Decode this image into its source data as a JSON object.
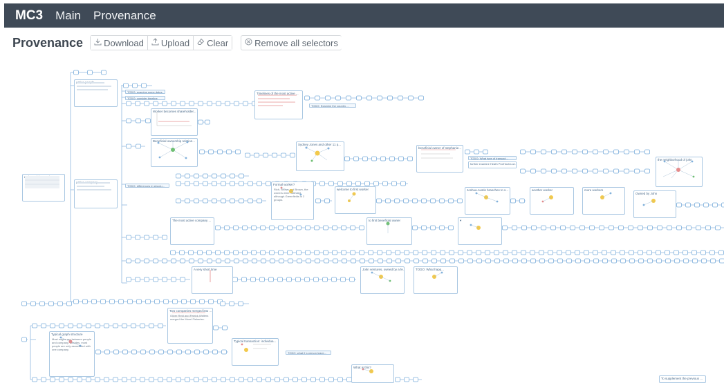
{
  "navbar": {
    "brand": "MC3",
    "links": [
      "Main",
      "Provenance"
    ]
  },
  "toolbar": {
    "title": "Provenance",
    "download_label": "Download",
    "upload_label": "Upload",
    "clear_label": "Clear",
    "remove_selectors_label": "Remove all selectors"
  },
  "icons": {
    "download": "download-icon",
    "upload": "upload-icon",
    "clear": "eraser-icon",
    "remove": "circle-x-icon"
  },
  "colors": {
    "navbar": "#3f4a57",
    "node": "#7fb0dc",
    "edge": "#8fb8df",
    "card_border": "#a9c7e2",
    "highlight": "#f2c94c"
  },
  "cards": {
    "entity_activity": "entity activity matrix",
    "active_people": "active people",
    "active_company": "active company",
    "timelines": "Timelines of the most active ...",
    "worker_shareholder": "Worker becomes shareholder...",
    "beneficial_relation": "Beneficial ownership relation...",
    "sydney_jones": "Sydney Jones and other 11 p...",
    "beneficial_stephanie": "beneficial owner of stephanie...",
    "neighborhood_john": "the neighborhood of john",
    "formal_worker": "Formal worker?",
    "formal_worker_note": "Rich, Brown and Brown, the owners when founded, although Greenfields is 2 groups.",
    "welcome_worker": "welcome to first worker",
    "joshua_austin": "Joshua Austin branches to s...",
    "another_worker": "another worker",
    "more_workers": "more workers",
    "owned_by_john": "Owned by John",
    "most_active_company": "The most active company ...",
    "first_beneficial": "to first beneficial owner",
    "short_time": "A very short time",
    "john_ventures": "John ventures, owned by a fe...",
    "todo_what_happ": "TODO: What happ...",
    "two_companies": "Two companies merged into ...",
    "two_companies_note": "Oliver Reid and Patrick Walters merged the Morel Fisheries.",
    "typical_structure": "Typical graph structure",
    "typical_structure_note": "Most edges are between people and company. Besides, most people are only associated with one company.",
    "typical_transaction": "Typical transaction: individua...",
    "what_is_this": "What is this?",
    "supplement": "To supplement the previous ..."
  },
  "tags": {
    "examine_dates": "TODO: examine some dates",
    "consider_timeline": "TODO: consider timeline",
    "examine_country": "TODO: Examine the country ...",
    "what_type": "TODO: What type of transact...",
    "what_type_note": "further examine Heath Pro/Hozha a.t., and Stephen Ryan.",
    "differences": "TODO: differences in structu...",
    "what_if_person": "TODO: what if a person leave..."
  }
}
